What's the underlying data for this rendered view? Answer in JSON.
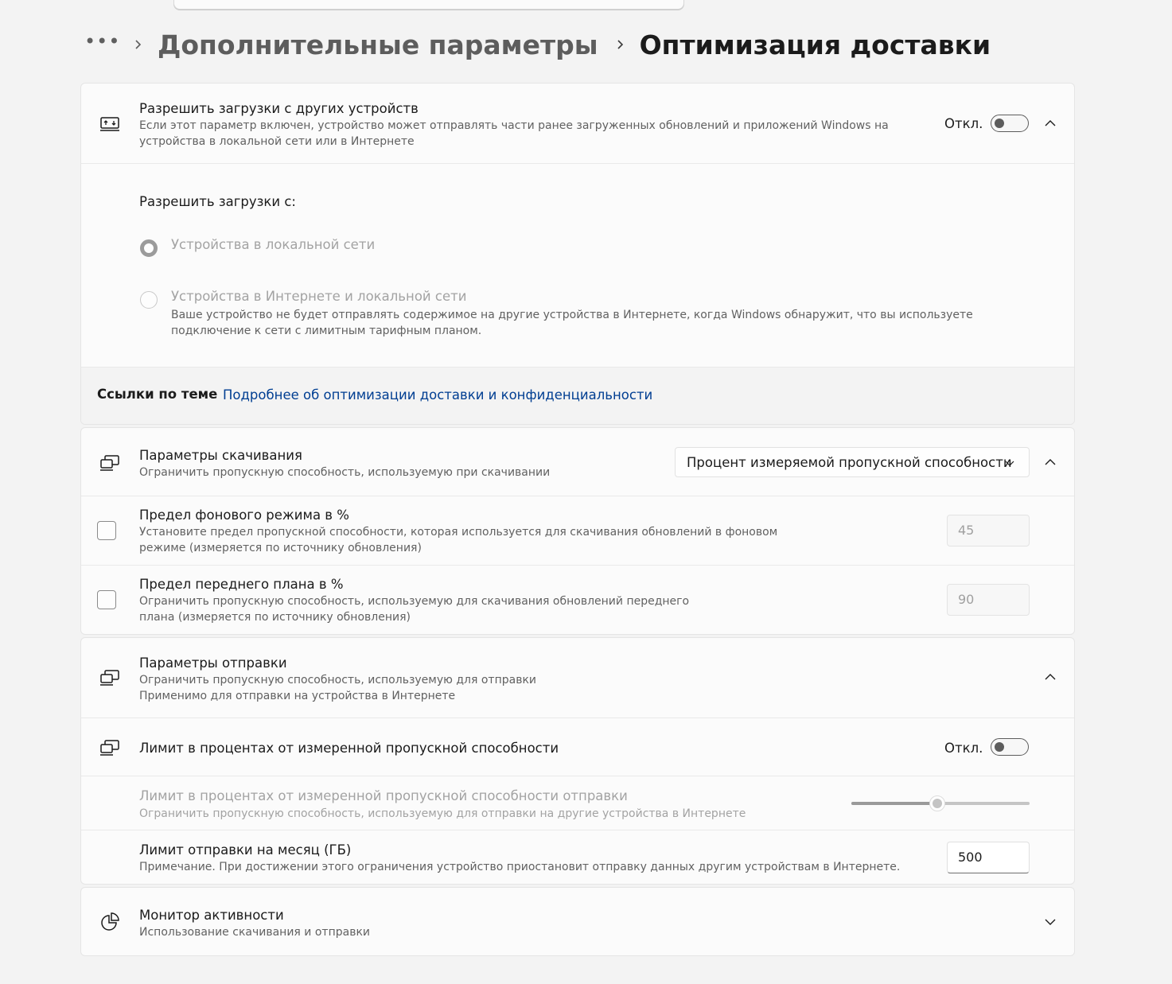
{
  "breadcrumb": {
    "more": "•••",
    "parent": "Дополнительные параметры",
    "current": "Оптимизация доставки"
  },
  "allow_downloads": {
    "title": "Разрешить загрузки с других устройств",
    "description": "Если этот параметр включен, устройство может отправлять части ранее загруженных обновлений и приложений Windows на устройства в локальной сети или в Интернете",
    "toggle_state": "Откл.",
    "from_label": "Разрешить загрузки с:",
    "options": [
      {
        "label": "Устройства в локальной сети",
        "selected": true,
        "desc": ""
      },
      {
        "label": "Устройства в Интернете и локальной сети",
        "selected": false,
        "desc": "Ваше устройство не будет отправлять содержимое на другие устройства в Интернете, когда Windows обнаружит, что вы используете подключение к сети с лимитным тарифным планом."
      }
    ]
  },
  "related": {
    "label": "Ссылки по теме",
    "link": "Подробнее об оптимизации доставки и конфиденциальности"
  },
  "download": {
    "title": "Параметры скачивания",
    "description": "Ограничить пропускную способность, используемую при скачивании",
    "dropdown_value": "Процент измеряемой пропускной способности",
    "background": {
      "title": "Предел фонового режима в %",
      "description": "Установите предел пропускной способности, которая используется для скачивания обновлений в фоновом режиме (измеряется по источнику обновления)",
      "value": "45"
    },
    "foreground": {
      "title": "Предел переднего плана в %",
      "description": "Ограничить пропускную способность, используемую для скачивания обновлений переднего плана (измеряется по источнику обновления)",
      "value": "90"
    }
  },
  "upload": {
    "title": "Параметры отправки",
    "description_1": "Ограничить пропускную способность, используемую для отправки",
    "description_2": "Применимо для отправки на устройства в Интернете",
    "limit_toggle": {
      "title": "Лимит в процентах от измеренной пропускной способности",
      "state": "Откл."
    },
    "limit_slider": {
      "title": "Лимит в процентах от измеренной пропускной способности отправки",
      "description": "Ограничить пропускную способность, используемую для отправки на другие устройства в Интернете",
      "level": 0.48
    },
    "monthly": {
      "title": "Лимит отправки на месяц (ГБ)",
      "description": "Примечание. При достижении этого ограничения устройство приостановит отправку данных другим устройствам в Интернете.",
      "value": "500"
    }
  },
  "activity": {
    "title": "Монитор активности",
    "description": "Использование скачивания и отправки"
  }
}
